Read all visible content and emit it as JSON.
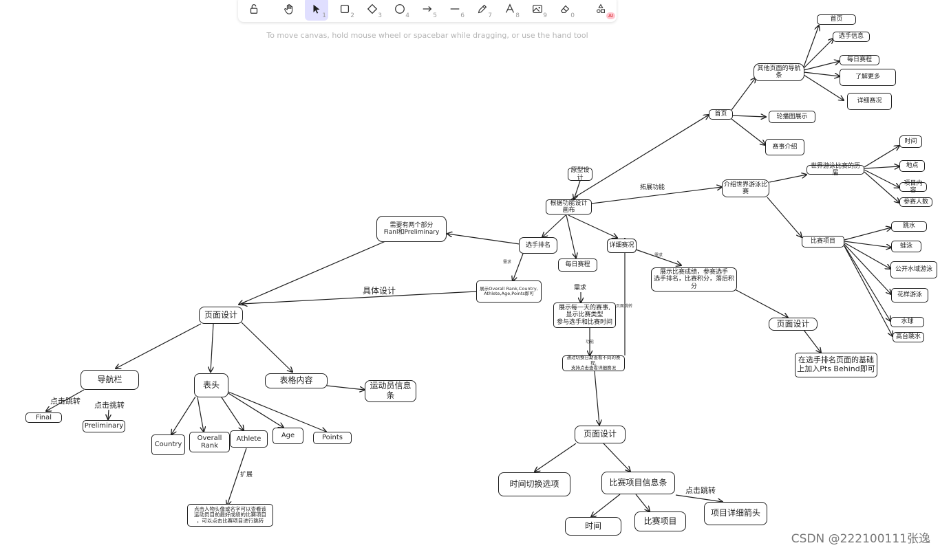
{
  "toolbar": {
    "tools": [
      {
        "name": "lock",
        "key": ""
      },
      {
        "name": "hand",
        "key": ""
      },
      {
        "name": "select",
        "key": "1",
        "active": true
      },
      {
        "name": "rectangle",
        "key": "2"
      },
      {
        "name": "diamond",
        "key": "3"
      },
      {
        "name": "ellipse",
        "key": "4"
      },
      {
        "name": "arrow",
        "key": "5"
      },
      {
        "name": "line",
        "key": "6"
      },
      {
        "name": "draw",
        "key": "7"
      },
      {
        "name": "text",
        "key": "8"
      },
      {
        "name": "image",
        "key": "9"
      },
      {
        "name": "eraser",
        "key": "0"
      },
      {
        "name": "more-tools",
        "key": ""
      }
    ],
    "ai_badge": "AI",
    "accent_color": "#e0dfff"
  },
  "hint": "To move canvas, hold mouse wheel or spacebar while dragging, or use the hand tool",
  "watermark": "CSDN @222100111张逸",
  "nodes": {
    "yuanxing": "原型设计",
    "genju": "根据功能设计画布",
    "shouye_r": "首页",
    "qita_nav": "其他页面的导航条",
    "nav_shouye": "首页",
    "nav_xuanshou": "选手信息",
    "nav_meiri": "每日赛程",
    "nav_liaojie": "了解更多",
    "nav_xiangxi": "详细赛况",
    "lunbo": "轮播图展示",
    "saishi": "赛事介绍",
    "jieshao": "介绍世界游泳比\n赛",
    "lishi": "世界游泳比赛的历届",
    "shijian_r": "时间",
    "didian": "地点",
    "xiangmu_nr": "项目内容",
    "cansai": "参赛人数",
    "bisai_xm": "比赛项目",
    "tiaoshui": "跳水",
    "wayong": "蛙泳",
    "gongkai": "公开水域游泳",
    "huayang": "花样游泳",
    "shuiqiu": "水球",
    "gaotai": "高台跳水",
    "xuanshou_pm": "选手排名",
    "liang_bufen": "需要有两个部分\nFianl和Preliminary",
    "zhanshi_rank": "展示Overall Rank,Country,\nAthlete,Age,Points即可",
    "yemian_l": "页面设计",
    "daohang": "导航栏",
    "final": "Final",
    "prelim": "Preliminary",
    "biaotou": "表头",
    "country": "Country",
    "overall": "Overall\nRank",
    "athlete": "Athlete",
    "age": "Age",
    "points": "Points",
    "biaoge": "表格内容",
    "yundong": "运动员信息条",
    "kuozhan_desc": "点击人物头像或名字可以查看该\n运动员目前最好成绩的比赛项目\n，可以点击比赛项目进行跳转",
    "meiri_sc": "每日赛程",
    "zhanshi_day": "展示每一天的赛事,\n显示比赛类型\n参与选手和比赛时间",
    "qiehuan_desc": "通过切换日期查看不同的赛程,\n支持点击查看详细赛况",
    "yemian_m": "页面设计",
    "shijian_qh": "时间切换选项",
    "bisai_info": "比赛项目信息条",
    "shijian_b": "时间",
    "bisai_xm_b": "比赛项目",
    "xiangmu_jt": "项目详细箭头",
    "xiangxi_sk": "详细赛况",
    "zhanshi_cj": "展示比赛成绩，参赛选手\n选手排名，比赛积分，落后积分",
    "yemian_r": "页面设计",
    "zaixuanshou": "在选手排名页面的基础\n上加入Pts Behind即可"
  },
  "labels": {
    "tuozhan": "拓展功能",
    "juti": "具体设计",
    "xuqiu_a": "需求",
    "xuqiu_b": "需求",
    "xuqiu_c": "需求",
    "gongneng": "功能",
    "yemian_tz": "页面跳转",
    "dianji_a": "点击跳转",
    "dianji_b": "点击挑转",
    "kuozhan": "扩展",
    "dianji_c": "点击跳转"
  }
}
